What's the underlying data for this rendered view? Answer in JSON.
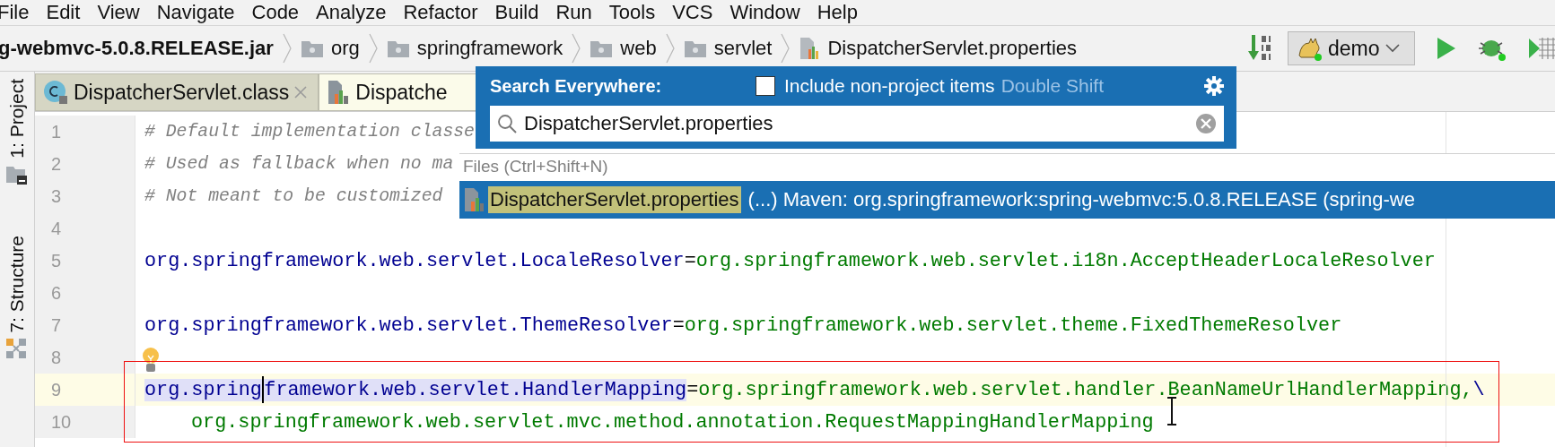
{
  "menu": [
    {
      "label": "File"
    },
    {
      "label": "Edit"
    },
    {
      "label": "View"
    },
    {
      "label": "Navigate"
    },
    {
      "label": "Code"
    },
    {
      "label": "Analyze"
    },
    {
      "label": "Refactor"
    },
    {
      "label": "Build"
    },
    {
      "label": "Run"
    },
    {
      "label": "Tools"
    },
    {
      "label": "VCS"
    },
    {
      "label": "Window"
    },
    {
      "label": "Help"
    }
  ],
  "breadcrumb": [
    {
      "kind": "jar",
      "label": "g-webmvc-5.0.8.RELEASE.jar"
    },
    {
      "kind": "folder",
      "label": "org"
    },
    {
      "kind": "folder",
      "label": "springframework"
    },
    {
      "kind": "folder",
      "label": "web"
    },
    {
      "kind": "folder",
      "label": "servlet"
    },
    {
      "kind": "file",
      "label": "DispatcherServlet.properties"
    }
  ],
  "toolbar": {
    "run_configuration": "demo"
  },
  "tabs": [
    {
      "kind": "class",
      "label": "DispatcherServlet.class",
      "selected": false,
      "closable": true
    },
    {
      "kind": "properties",
      "label": "Dispatche",
      "selected": true,
      "closable": false
    }
  ],
  "tool_windows": [
    {
      "kind": "project",
      "label": "1: Project"
    },
    {
      "kind": "structure",
      "label": "7: Structure"
    }
  ],
  "editor": {
    "lines": [
      {
        "number": "1",
        "current": false,
        "bulb": false,
        "continuation": false,
        "segments": [
          {
            "kind": "comment",
            "text": "# Default implementation classe"
          }
        ]
      },
      {
        "number": "2",
        "current": false,
        "bulb": false,
        "continuation": false,
        "segments": [
          {
            "kind": "comment",
            "text": "# Used as fallback when no ma"
          }
        ]
      },
      {
        "number": "3",
        "current": false,
        "bulb": false,
        "continuation": false,
        "segments": [
          {
            "kind": "comment",
            "text": "# Not meant to be customized"
          }
        ]
      },
      {
        "number": "4",
        "current": false,
        "bulb": false
      },
      {
        "number": "5",
        "current": false,
        "bulb": false,
        "continuation": false,
        "segments": [
          {
            "kind": "key",
            "text": "org.springframework.web.servlet.LocaleResolver",
            "highlighted": false
          },
          {
            "kind": "separator",
            "text": "="
          },
          {
            "kind": "value",
            "text": "org.springframework.web.servlet.i18n.AcceptHeaderLocaleResolver"
          }
        ]
      },
      {
        "number": "6",
        "current": false,
        "bulb": false
      },
      {
        "number": "7",
        "current": false,
        "bulb": false,
        "continuation": false,
        "segments": [
          {
            "kind": "key",
            "text": "org.springframework.web.servlet.ThemeResolver",
            "highlighted": false
          },
          {
            "kind": "separator",
            "text": "="
          },
          {
            "kind": "value",
            "text": "org.springframework.web.servlet.theme.FixedThemeResolver"
          }
        ]
      },
      {
        "number": "8",
        "current": false,
        "bulb": true
      },
      {
        "number": "9",
        "current": true,
        "bulb": false,
        "continuation": false,
        "segments": [
          {
            "kind": "key",
            "text": "org.spring",
            "highlighted": true
          },
          {
            "kind": "caret"
          },
          {
            "kind": "key",
            "text": "framework.web.servlet.HandlerMapping",
            "highlighted": true
          },
          {
            "kind": "separator",
            "text": "="
          },
          {
            "kind": "value",
            "text": "org.springframework.web.servlet.handler.BeanNameUrlHandlerMapping,"
          },
          {
            "kind": "escape",
            "text": "\\"
          }
        ]
      },
      {
        "number": "10",
        "current": false,
        "bulb": false,
        "continuation": true,
        "segments": [
          {
            "kind": "value",
            "text": "org.springframework.web.servlet.mvc.method.annotation.RequestMappingHandlerMapping"
          }
        ]
      }
    ]
  },
  "search_everywhere": {
    "title": "Search Everywhere:",
    "include_non_project": {
      "label": "Include non-project items",
      "checked": false
    },
    "shortcut_hint": "Double Shift",
    "query": "DispatcherServlet.properties",
    "results_header": "Files (Ctrl+Shift+N)",
    "results": [
      {
        "name": "DispatcherServlet.properties",
        "location": "(...) Maven: org.springframework:spring-webmvc:5.0.8.RELEASE (spring-we",
        "selected": true
      }
    ]
  },
  "annotation_frame": true
}
